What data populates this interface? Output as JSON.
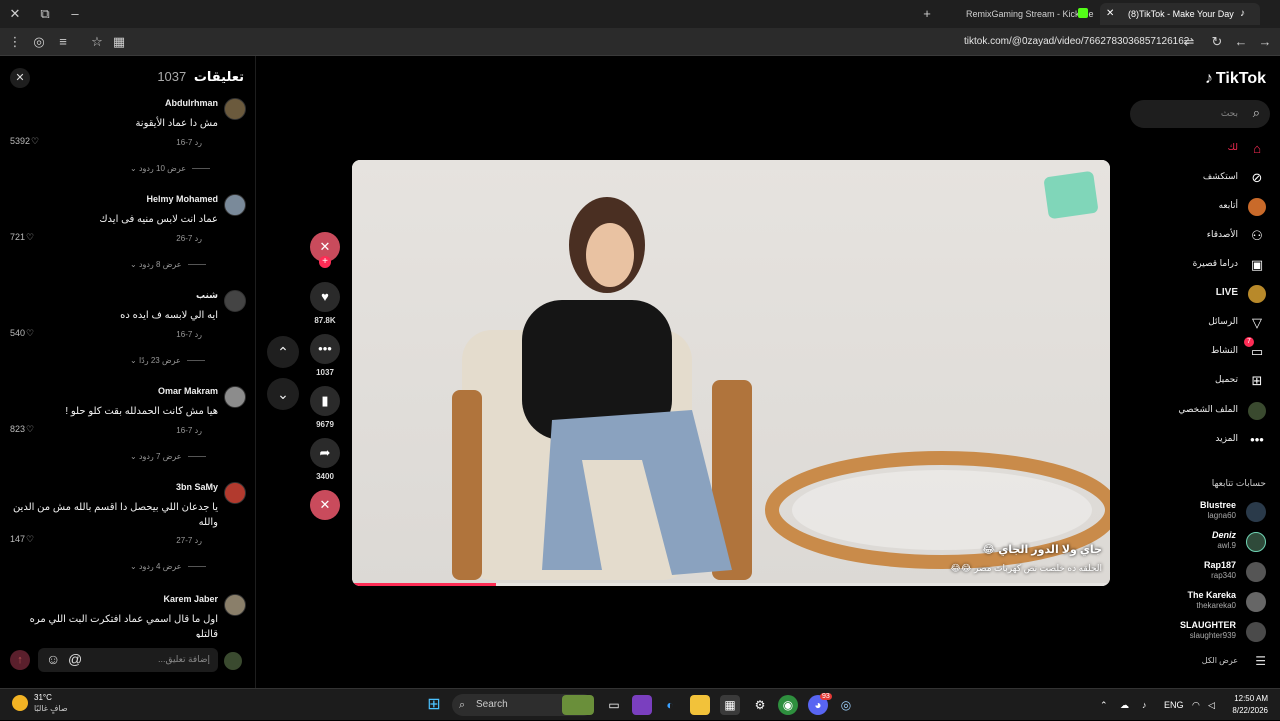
{
  "browser": {
    "tabs": [
      {
        "title": "RemixGaming Stream - Kick De",
        "active": false
      },
      {
        "title": "(8)TikTok - Make Your Day",
        "active": true
      }
    ],
    "url": "tiktok.com/@0zayad/video/7662783036857126162"
  },
  "comments": {
    "title": "تعليقات",
    "count": "1037",
    "items": [
      {
        "author": "Abdulrhman",
        "text": "مش دا عماد الأيقونة",
        "date": "7-16",
        "reply": "رد",
        "likes": "5392",
        "replies": "عرض 10 ردود"
      },
      {
        "author": "Helmy Mohamed",
        "text": "عماد انت لابس منيه فى ايدك",
        "date": "7-26",
        "reply": "رد",
        "likes": "721",
        "replies": "عرض 8 ردود"
      },
      {
        "author": "شنب",
        "text": "ايه الي لابسه ف ايده ده",
        "date": "7-16",
        "reply": "رد",
        "likes": "540",
        "replies": "عرض 23 ردًا"
      },
      {
        "author": "Omar Makram",
        "text": "هيا مش كانت الحمدلله بقت كلو حلو !",
        "date": "7-16",
        "reply": "رد",
        "likes": "823",
        "replies": "عرض 7 ردود"
      },
      {
        "author": "3bn SaMy",
        "text": "يا جدعان اللي بيحصل دا اقسم بالله مش من الدين والله",
        "date": "7-27",
        "reply": "رد",
        "likes": "147",
        "replies": "عرض 4 ردود"
      },
      {
        "author": "Karem Jaber",
        "text": "اول ما قال اسمي عماد افتكرت البت اللي مره قالتلو",
        "date": "",
        "reply": "",
        "likes": "",
        "replies": ""
      }
    ],
    "input_placeholder": "إضافة تعليق..."
  },
  "actions": {
    "likes": "87.8K",
    "comments": "1037",
    "saves": "9679",
    "shares": "3400"
  },
  "video": {
    "caption_line1": "جاي ولا الدور الجاي 😂",
    "caption_line2": "الحلقه ده خلصت نص كهربات مصر 😂😂",
    "progress": 0.19
  },
  "sidebar": {
    "logo": "TikTok",
    "search_placeholder": "بحث",
    "nav": [
      {
        "label": "لك",
        "icon": "home-icon",
        "active": true
      },
      {
        "label": "استكشف",
        "icon": "compass-icon",
        "active": false
      },
      {
        "label": "أتابعه",
        "icon": "following-icon",
        "active": false
      },
      {
        "label": "الأصدقاء",
        "icon": "friends-icon",
        "active": false
      },
      {
        "label": "دراما قصيرة",
        "icon": "drama-icon",
        "active": false
      },
      {
        "label": "LIVE",
        "icon": "live-icon",
        "active": false
      },
      {
        "label": "الرسائل",
        "icon": "messages-icon",
        "active": false
      },
      {
        "label": "النشاط",
        "icon": "activity-icon",
        "active": false,
        "badge": "7"
      },
      {
        "label": "تحميل",
        "icon": "upload-icon",
        "active": false
      },
      {
        "label": "الملف الشخصي",
        "icon": "profile-icon",
        "active": false
      },
      {
        "label": "المزيد",
        "icon": "more-icon",
        "active": false
      }
    ],
    "following_title": "حسابات تتابعها",
    "following": [
      {
        "name": "Blustree",
        "handle": "lagna60"
      },
      {
        "name": "Deniz",
        "handle": "awl.9"
      },
      {
        "name": "Rap187",
        "handle": "rap340"
      },
      {
        "name": "The Kareka",
        "handle": "thekareka0"
      },
      {
        "name": "SLAUGHTER",
        "handle": "slaughter939"
      }
    ],
    "show_all": "عرض الكل"
  },
  "taskbar": {
    "weather_temp": "31°C",
    "weather_desc": "صافٍ غالبًا",
    "search_label": "Search",
    "lang": "ENG",
    "time": "12:50 AM",
    "date": "8/22/2026",
    "chrome_badge": "7",
    "discord_badge": "93"
  }
}
